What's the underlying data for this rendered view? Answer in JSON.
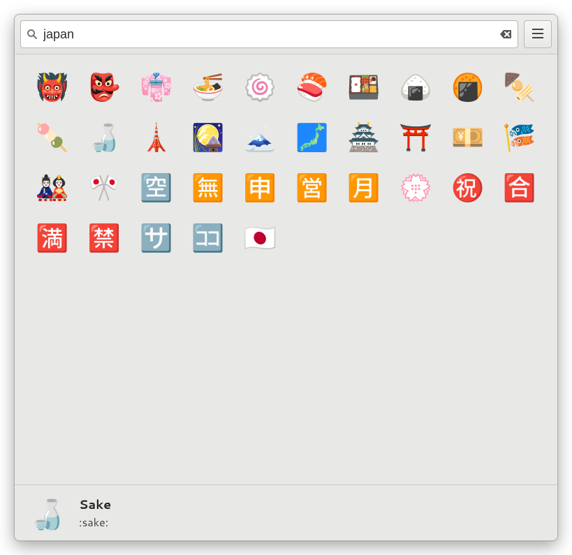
{
  "search": {
    "value": "japan",
    "placeholder": "Search"
  },
  "emojis": [
    {
      "char": "👹",
      "name": "japanese-ogre"
    },
    {
      "char": "👺",
      "name": "japanese-goblin"
    },
    {
      "char": "👘",
      "name": "kimono"
    },
    {
      "char": "🍜",
      "name": "ramen"
    },
    {
      "char": "🍥",
      "name": "fish-cake"
    },
    {
      "char": "🍣",
      "name": "sushi"
    },
    {
      "char": "🍱",
      "name": "bento"
    },
    {
      "char": "🍙",
      "name": "rice-ball"
    },
    {
      "char": "🍘",
      "name": "rice-cracker"
    },
    {
      "char": "🍢",
      "name": "oden"
    },
    {
      "char": "🍡",
      "name": "dango"
    },
    {
      "char": "🍶",
      "name": "sake"
    },
    {
      "char": "🗼",
      "name": "tokyo-tower"
    },
    {
      "char": "🎑",
      "name": "moon-viewing"
    },
    {
      "char": "🗻",
      "name": "mount-fuji"
    },
    {
      "char": "🗾",
      "name": "japan-map"
    },
    {
      "char": "🏯",
      "name": "japanese-castle"
    },
    {
      "char": "⛩️",
      "name": "shinto-shrine"
    },
    {
      "char": "💴",
      "name": "yen-banknote"
    },
    {
      "char": "🎏",
      "name": "carp-streamer"
    },
    {
      "char": "🎎",
      "name": "japanese-dolls"
    },
    {
      "char": "🎌",
      "name": "crossed-flags"
    },
    {
      "char": "🈳",
      "name": "ja-vacancy"
    },
    {
      "char": "🈚",
      "name": "ja-free-of-charge"
    },
    {
      "char": "🈸",
      "name": "ja-application"
    },
    {
      "char": "🈺",
      "name": "ja-open-for-business"
    },
    {
      "char": "🈷️",
      "name": "ja-monthly"
    },
    {
      "char": "💮",
      "name": "white-flower"
    },
    {
      "char": "㊗️",
      "name": "ja-congratulations"
    },
    {
      "char": "🈴",
      "name": "ja-passing-grade"
    },
    {
      "char": "🈵",
      "name": "ja-no-vacancy"
    },
    {
      "char": "🈲",
      "name": "ja-prohibited"
    },
    {
      "char": "🈂️",
      "name": "ja-service-charge"
    },
    {
      "char": "🈁",
      "name": "ja-here"
    },
    {
      "char": "🇯🇵",
      "name": "flag-japan"
    }
  ],
  "selected": {
    "char": "🍶",
    "name": "Sake",
    "code": ":sake:"
  }
}
